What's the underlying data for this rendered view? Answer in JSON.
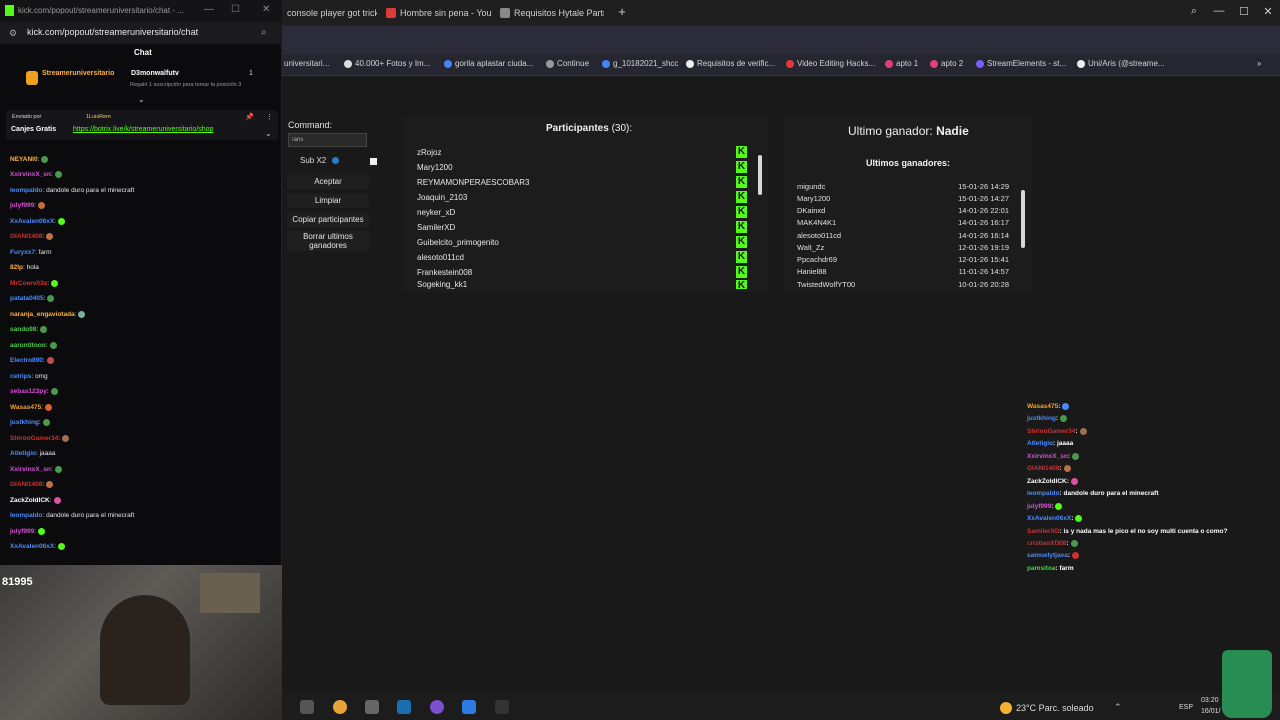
{
  "browser": {
    "tabs": [
      {
        "label": "console player got tricked",
        "color": "#e03b3b"
      },
      {
        "label": "Hombre sin pena - YouTube",
        "color": "#e03b3b"
      },
      {
        "label": "Requisitos Hytale Partner",
        "color": "#888888"
      }
    ],
    "new_tab": "+",
    "window_controls": [
      "—",
      "☐",
      "✕"
    ],
    "bookmarks": [
      "universitari...",
      "40.000+ Fotos y Im...",
      "gorila aplastar ciuda...",
      "Continue",
      "g_10182021_shcc",
      "Requisitos de verific...",
      "Video Editing Hacks...",
      "apto 1",
      "apto 2",
      "StreamElements - st...",
      "Uni/Aris (@streame..."
    ]
  },
  "giveaway": {
    "command_label": "Command:",
    "command_value": "!aris",
    "sub_label": "Sub X2",
    "buttons": [
      "Aceptar",
      "Limpiar",
      "Copiar participantes",
      "Borrar ultimos ganadores"
    ],
    "participants_label": "Participantes",
    "participants_count": "(30):",
    "participants": [
      "zRojoz",
      "Mary1200",
      "REYMAMONPERAESCOBAR3",
      "Joaquin_2103",
      "neyker_xD",
      "SamilerXD",
      "Guibelcito_primogenito",
      "alesoto011cd",
      "Frankestein008",
      "Sogeking_kk1"
    ],
    "last_winner_label": "Ultimo ganador:",
    "last_winner_name": "Nadie",
    "winners_title": "Ultimos ganadores:",
    "winners": [
      {
        "name": "migundc",
        "date": "15-01-26 14:29"
      },
      {
        "name": "Mary1200",
        "date": "15-01-26 14:27"
      },
      {
        "name": "DKainxd",
        "date": "14-01-26 22:01"
      },
      {
        "name": "MAK4N4K1",
        "date": "14-01-26 16:17"
      },
      {
        "name": "alesoto011cd",
        "date": "14-01-26 16:14"
      },
      {
        "name": "Walt_Zz",
        "date": "12-01-26 19:19"
      },
      {
        "name": "Ppcachdr69",
        "date": "12-01-26 15:41"
      },
      {
        "name": "Haniel88",
        "date": "11-01-26 14:57"
      },
      {
        "name": "TwistedWolfYT00",
        "date": "10-01-26 20:28"
      }
    ]
  },
  "overlay_chat": [
    {
      "user": "Wasas475",
      "color": "#f0a030",
      "msg": ":"
    },
    {
      "user": "justkhing",
      "color": "#4a8cff",
      "msg": ":"
    },
    {
      "user": "ShirooGamer34",
      "color": "#d03030",
      "msg": ":"
    },
    {
      "user": "Atletigio",
      "color": "#4a8cff",
      "msg": ": jaaaa"
    },
    {
      "user": "XxirvinxX_sn",
      "color": "#d84fd8",
      "msg": ":"
    },
    {
      "user": "GIANI1408",
      "color": "#d03030",
      "msg": ":"
    },
    {
      "user": "ZackZoldICK",
      "color": "#ffffff",
      "msg": ":"
    },
    {
      "user": "leompaldo",
      "color": "#4a8cff",
      "msg": ": dandole duro para el minecraft"
    },
    {
      "user": "julyf999",
      "color": "#d84fd8",
      "msg": ":"
    },
    {
      "user": "XxAvalen06xX",
      "color": "#4a8cff",
      "msg": ":"
    },
    {
      "user": "SamilerXD",
      "color": "#d03030",
      "msg": ": is y nada mas le pico el no soy multi cuenta o como?"
    },
    {
      "user": "cristianXD08",
      "color": "#d03030",
      "msg": ":"
    },
    {
      "user": "samuelytjava",
      "color": "#4a8cff",
      "msg": ":"
    },
    {
      "user": "pamsitoa",
      "color": "#4ad04a",
      "msg": ": farm"
    }
  ],
  "kick_chat": {
    "window_title": "kick.com/popout/streameruniversitario/chat - ...",
    "url": "kick.com/popout/streameruniversitario/chat",
    "header": "Chat",
    "pinned_user": "Streameruniversitario",
    "pinned_gifter": "D3monwalfutv",
    "pinned_count": "1",
    "pinned_sub": "Regaló 1 suscripción para tomar la posición 3",
    "sent_by_label": "Enviado por",
    "sent_by_user": "1LuisRem",
    "canjes_label": "Canjes Gratis",
    "canjes_link": "https://botrix.live/k/streameruniversitario/shop",
    "messages": [
      {
        "user": "NEYANI0",
        "color": "#ffb23e",
        "msg": ":"
      },
      {
        "user": "XxirvinxX_sn",
        "color": "#d84fd8",
        "msg": ":"
      },
      {
        "user": "leompaldo",
        "color": "#4a8cff",
        "msg": ": dandole duro para el minecraft"
      },
      {
        "user": "julyf999",
        "color": "#d84fd8",
        "msg": ":"
      },
      {
        "user": "XxAvalen06xX",
        "color": "#4a8cff",
        "msg": ":"
      },
      {
        "user": "GIANI1408",
        "color": "#d03030",
        "msg": ":"
      },
      {
        "user": "Furyxx7",
        "color": "#4a8cff",
        "msg": ": farm"
      },
      {
        "user": "82lp",
        "color": "#ffb23e",
        "msg": ": hola"
      },
      {
        "user": "MrCoerv03x",
        "color": "#d03030",
        "msg": ":"
      },
      {
        "user": "patata0405",
        "color": "#4a8cff",
        "msg": ":"
      },
      {
        "user": "naranja_engaviotada",
        "color": "#ffb23e",
        "msg": ":"
      },
      {
        "user": "sando98",
        "color": "#4ad04a",
        "msg": ":"
      },
      {
        "user": "aarontitooo",
        "color": "#4ad04a",
        "msg": ":"
      },
      {
        "user": "Electro890",
        "color": "#4a8cff",
        "msg": ":"
      },
      {
        "user": "cetrips",
        "color": "#4a8cff",
        "msg": ": omg"
      },
      {
        "user": "sebas123py",
        "color": "#d84fd8",
        "msg": ":"
      },
      {
        "user": "Wasas475",
        "color": "#f0a030",
        "msg": ":"
      },
      {
        "user": "justkhing",
        "color": "#4a8cff",
        "msg": ":"
      },
      {
        "user": "ShirooGamer34",
        "color": "#d03030",
        "msg": ":"
      },
      {
        "user": "Atletigio",
        "color": "#4a8cff",
        "msg": ": jaaaa"
      },
      {
        "user": "XxirvinxX_sn",
        "color": "#d84fd8",
        "msg": ":"
      },
      {
        "user": "GIANI1408",
        "color": "#d03030",
        "msg": ":"
      },
      {
        "user": "ZackZoldICK",
        "color": "#ffffff",
        "msg": ":"
      },
      {
        "user": "leompaldo",
        "color": "#4a8cff",
        "msg": ": dandole duro para el minecraft"
      },
      {
        "user": "julyf999",
        "color": "#d84fd8",
        "msg": ":"
      },
      {
        "user": "XxAvalen06xX",
        "color": "#4a8cff",
        "msg": ":"
      }
    ],
    "viewer_count": "81995"
  },
  "taskbar": {
    "weather": "23°C  Parc. soleado",
    "lang": "ESP",
    "time": "03:20",
    "date": "16/01/"
  },
  "colors": {
    "kick_green": "#53fc18",
    "page_bg": "#191919",
    "panel_bg": "#1c1c1c"
  }
}
